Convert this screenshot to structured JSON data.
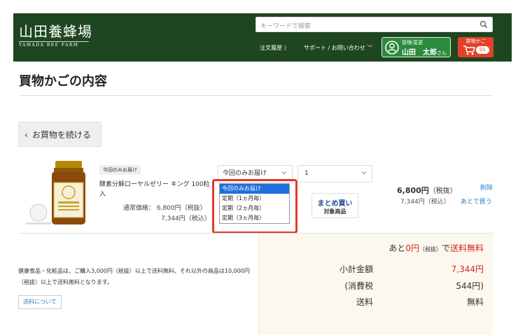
{
  "header": {
    "logo_main": "山田養蜂場",
    "logo_sub": "YAMADA BEE FARM",
    "search_placeholder": "キーワードで検索",
    "nav_order_history": "注文履歴 〉",
    "nav_support": "サポート / お問い合わせ ﹀",
    "user_line1": "管理/変更",
    "user_name": "山田　太郎",
    "user_suffix": "さん",
    "cart_label": "買物かご",
    "cart_count": "01"
  },
  "page": {
    "title": "買物かごの内容",
    "continue_label": "お買物を続ける"
  },
  "item": {
    "tag": "今回のみお届け",
    "name": "酵素分解ローヤルゼリー キング 100粒入",
    "regular_price": "通常価格：  6,800円（税抜）",
    "regular_price_tax": "7,344円（税込）",
    "delivery_selected": "今回のみお届け",
    "quantity": "1",
    "delivery_options": [
      "今回のみお届け",
      "定期（1ヵ月毎）",
      "定期（2ヵ月毎）",
      "定期（3ヵ月毎）"
    ],
    "matome_main": "まとめ買い",
    "matome_sub": "対象商品",
    "price_value": "6,800円",
    "price_suffix": "（税抜）",
    "price_tax": "7,344円（税込）",
    "delete_label": "削除",
    "later_label": "あとで買う"
  },
  "shipping": {
    "note": "健康食品・化粧品は、ご購入3,000円（税抜）以上で送料無料、それ以外の商品は10,000円（税抜）以上で送料無料となります。",
    "link_label": "送料について"
  },
  "summary": {
    "free_ship_prefix": "あと",
    "free_ship_amount": "0円",
    "free_ship_tax": "（税抜）",
    "free_ship_middle": "で",
    "free_ship_suffix": "送料無料",
    "subtotal_label": "小計金額",
    "subtotal_value": "7,344円",
    "tax_label": "(消費税",
    "tax_value": "544円)",
    "shipping_label": "送料",
    "shipping_value": "無料"
  },
  "colors": {
    "header_bg": "#1e4620",
    "user_btn": "#2c8a3d",
    "cart_btn": "#e2422c",
    "accent_red": "#d9261c",
    "link_blue": "#2a7ec7",
    "highlight_border": "#e53925"
  }
}
